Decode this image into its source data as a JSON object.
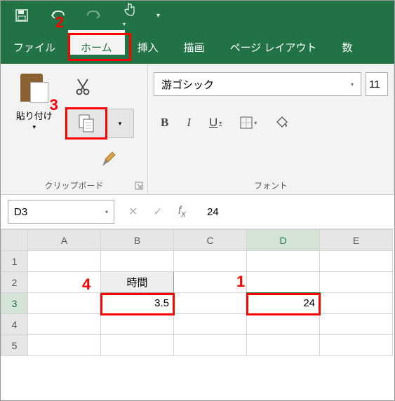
{
  "titlebar": {
    "save": "💾"
  },
  "tabs": {
    "file": "ファイル",
    "home": "ホーム",
    "insert": "挿入",
    "draw": "描画",
    "pagelayout": "ページ レイアウト",
    "formulas": "数"
  },
  "ribbon": {
    "clipboard": {
      "paste": "貼り付け",
      "group_label": "クリップボード"
    },
    "font": {
      "name": "游ゴシック",
      "size": "11",
      "bold": "B",
      "italic": "I",
      "underline": "U",
      "group_label": "フォント"
    }
  },
  "formula_bar": {
    "namebox": "D3",
    "value": "24"
  },
  "sheet": {
    "cols": [
      "A",
      "B",
      "C",
      "D",
      "E"
    ],
    "rows": [
      "1",
      "2",
      "3",
      "4",
      "5"
    ],
    "b2": "時間",
    "b3": "3.5",
    "d3": "24"
  },
  "callouts": {
    "c1": "1",
    "c2": "2",
    "c3": "3",
    "c4": "4"
  }
}
